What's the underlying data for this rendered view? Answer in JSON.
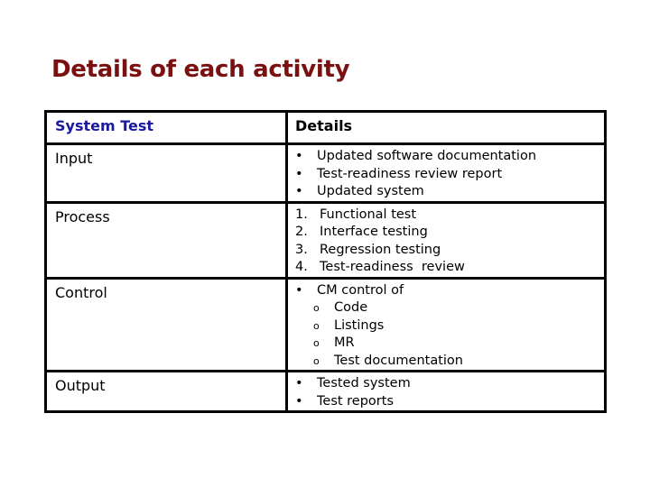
{
  "title": "Details of each activity",
  "table": {
    "header": {
      "col1": "System Test",
      "col2": "Details"
    },
    "rows": {
      "input": {
        "label": "Input",
        "items": [
          "Updated software documentation",
          "Test-readiness review report",
          "Updated system"
        ],
        "marker": "•"
      },
      "process": {
        "label": "Process",
        "items": [
          "Functional test",
          "Interface testing",
          "Regression testing",
          "Test-readiness  review"
        ],
        "markers": [
          "1.",
          "2.",
          "3.",
          "4."
        ]
      },
      "control": {
        "label": "Control",
        "item": "CM control of",
        "marker": "•",
        "subitems": [
          "Code",
          "Listings",
          "MR",
          "Test documentation"
        ],
        "submarker": "o"
      },
      "output": {
        "label": "Output",
        "items": [
          "Tested system",
          "Test reports"
        ],
        "marker": "•"
      }
    }
  },
  "colors": {
    "title": "#7a1010",
    "header_label": "#1a1aa0"
  }
}
